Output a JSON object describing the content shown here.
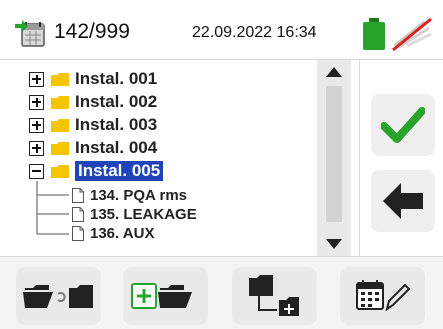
{
  "status": {
    "counter": "142/999",
    "datetime": "22.09.2022 16:34",
    "icons": [
      "memory-icon",
      "battery-icon",
      "wifi-off-icon"
    ],
    "battery_color": "#2aa32a",
    "signal_off_color": "#e02020"
  },
  "tree": {
    "folders": [
      {
        "label": "Instal. 001",
        "expanded": false,
        "selected": false
      },
      {
        "label": "Instal. 002",
        "expanded": false,
        "selected": false
      },
      {
        "label": "Instal. 003",
        "expanded": false,
        "selected": false
      },
      {
        "label": "Instal. 004",
        "expanded": false,
        "selected": false
      },
      {
        "label": "Instal. 005",
        "expanded": true,
        "selected": true
      }
    ],
    "files": [
      {
        "label": "134. PQA rms"
      },
      {
        "label": "135. LEAKAGE"
      },
      {
        "label": "136. AUX"
      }
    ],
    "folder_color": "#f5c400",
    "selection_color": "#1f44b8"
  },
  "side_buttons": [
    "confirm-check-icon",
    "back-arrow-icon"
  ],
  "toolbar": [
    "rename-folder-icon",
    "new-folder-icon",
    "new-subfolder-icon",
    "edit-calendar-icon"
  ]
}
